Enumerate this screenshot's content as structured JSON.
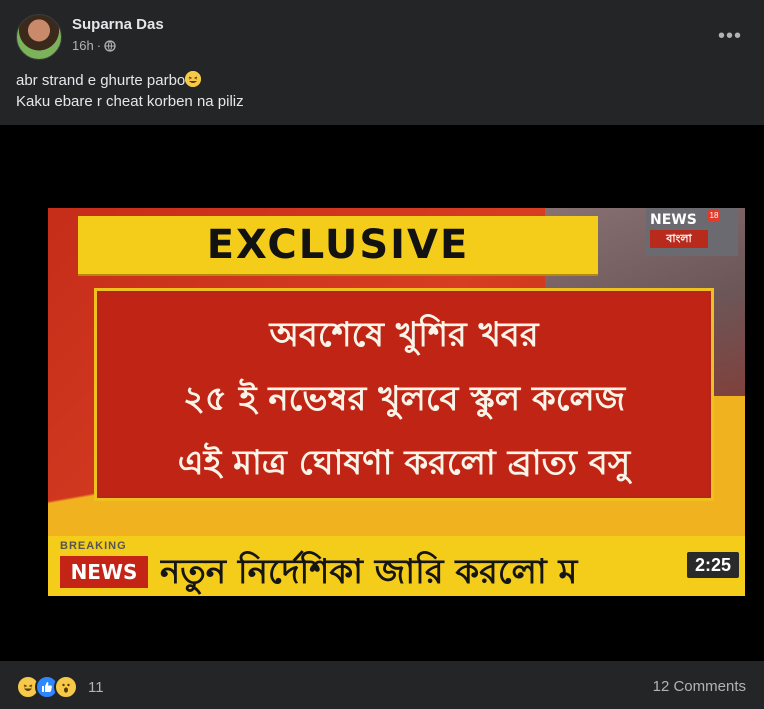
{
  "post": {
    "author": "Suparna Das",
    "time": "16h",
    "separator": "·",
    "more_label": "•••",
    "text_line1": "abr strand e ghurte parbo",
    "text_emoji": "grinning-squinting-emoji",
    "text_line2": "Kaku ebare r cheat korben na piliz"
  },
  "image": {
    "exclusive": "EXCLUSIVE",
    "logo_top": "NEWS",
    "logo_bottom": "বাংলা",
    "logo_number": "18",
    "line1": "অবশেষে খুশির খবর",
    "line2": "২৫ ই নভেম্বর খুলবে স্কুল কলেজ",
    "line3": "এই মাত্র ঘোষণা করলো ব্রাত্য বসু",
    "breaking": "BREAKING",
    "news": "NEWS",
    "ticker": "নতুন নির্দেশিকা জারি করলো ম",
    "time": "2:25"
  },
  "footer": {
    "reaction_count": "11",
    "comments": "12 Comments",
    "reactions": [
      "haha",
      "like",
      "wow"
    ]
  },
  "colors": {
    "background": "#242526",
    "text": "#e4e6eb",
    "muted": "#b0b3b8",
    "like": "#2d88ff"
  }
}
